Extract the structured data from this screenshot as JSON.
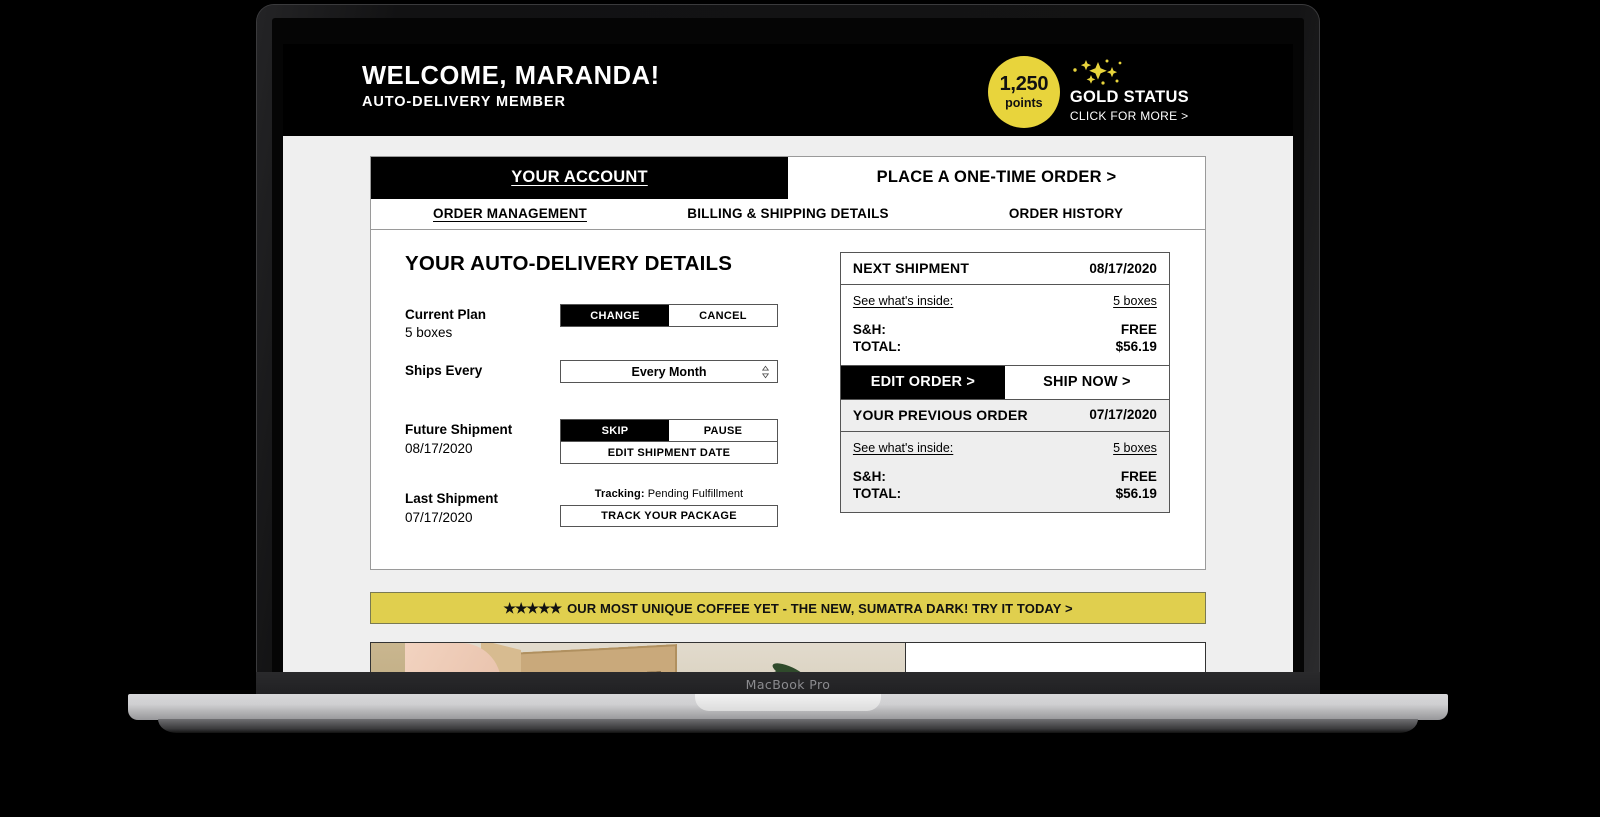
{
  "device": {
    "model_label": "MacBook Pro"
  },
  "header": {
    "welcome_title": "WELCOME, MARANDA!",
    "subtitle": "AUTO-DELIVERY MEMBER",
    "points_value": "1,250",
    "points_label": "points",
    "status_label": "GOLD STATUS",
    "status_cta": "CLICK FOR MORE >",
    "badge_color": "#e8d43c"
  },
  "primary_tabs": [
    {
      "label": "YOUR ACCOUNT",
      "active": true
    },
    {
      "label": "PLACE A ONE-TIME ORDER >",
      "active": false
    }
  ],
  "secondary_tabs": [
    {
      "label": "ORDER MANAGEMENT",
      "active": true
    },
    {
      "label": "BILLING & SHIPPING DETAILS",
      "active": false
    },
    {
      "label": "ORDER HISTORY",
      "active": false
    }
  ],
  "details": {
    "heading": "YOUR AUTO-DELIVERY DETAILS",
    "current_plan": {
      "label": "Current Plan",
      "value": "5 boxes",
      "change_label": "CHANGE",
      "cancel_label": "CANCEL"
    },
    "ships_every": {
      "label": "Ships Every",
      "selected": "Every Month"
    },
    "future_shipment": {
      "label": "Future Shipment",
      "date": "08/17/2020",
      "skip_label": "SKIP",
      "pause_label": "PAUSE",
      "edit_date_label": "EDIT SHIPMENT DATE"
    },
    "last_shipment": {
      "label": "Last Shipment",
      "date": "07/17/2020",
      "tracking_label": "Tracking:",
      "tracking_status": "Pending Fulfillment",
      "track_button_label": "TRACK YOUR PACKAGE"
    }
  },
  "next_shipment": {
    "title": "NEXT SHIPMENT",
    "date": "08/17/2020",
    "see_inside_label": "See what's inside:",
    "boxes": "5 boxes",
    "sh_label": "S&H:",
    "sh_value": "FREE",
    "total_label": "TOTAL:",
    "total_value": "$56.19",
    "edit_order_label": "EDIT ORDER  >",
    "ship_now_label": "SHIP NOW  >"
  },
  "previous_order": {
    "title": "YOUR PREVIOUS ORDER",
    "date": "07/17/2020",
    "see_inside_label": "See what's inside:",
    "boxes": "5 boxes",
    "sh_label": "S&H:",
    "sh_value": "FREE",
    "total_label": "TOTAL:",
    "total_value": "$56.19"
  },
  "promo": {
    "stars": "★★★★★",
    "text": "OUR MOST UNIQUE COFFEE YET - THE NEW, SUMATRA DARK! TRY IT TODAY >",
    "background": "#e0cf4e"
  }
}
